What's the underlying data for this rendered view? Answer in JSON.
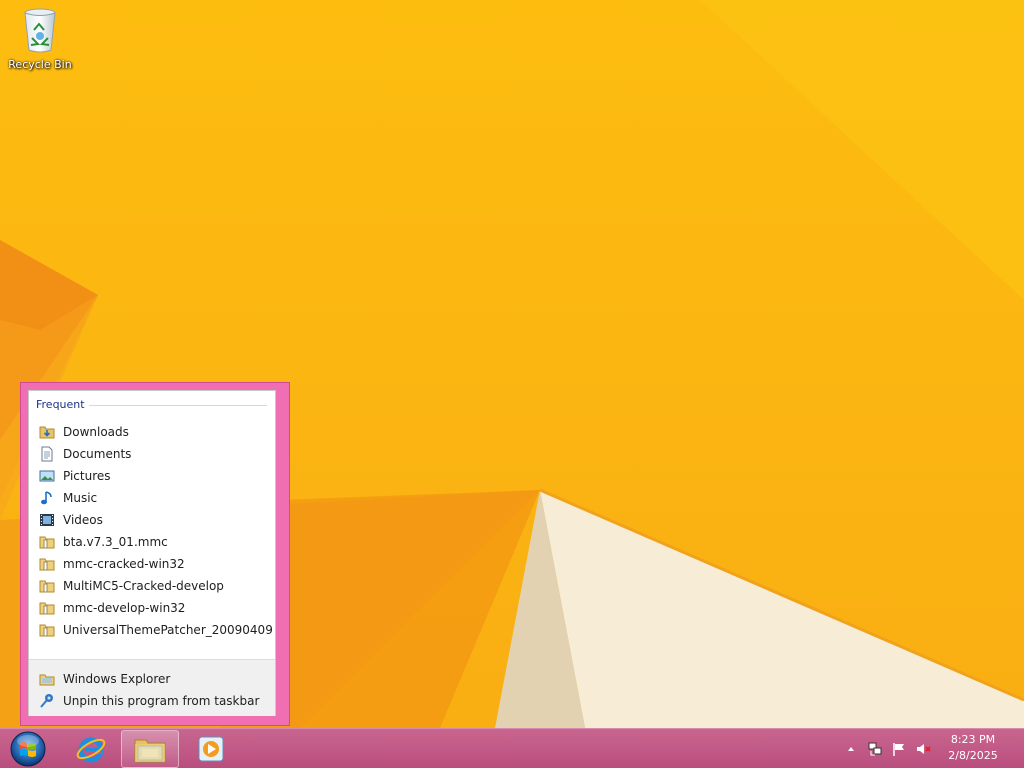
{
  "desktop": {
    "recycle_bin_label": "Recycle Bin"
  },
  "jumplist": {
    "header": "Frequent",
    "frequent_items": [
      {
        "label": "Downloads",
        "icon": "downloads-folder-icon"
      },
      {
        "label": "Documents",
        "icon": "documents-icon"
      },
      {
        "label": "Pictures",
        "icon": "pictures-icon"
      },
      {
        "label": "Music",
        "icon": "music-icon"
      },
      {
        "label": "Videos",
        "icon": "videos-icon"
      },
      {
        "label": "bta.v7.3_01.mmc",
        "icon": "folder-icon"
      },
      {
        "label": "mmc-cracked-win32",
        "icon": "folder-icon"
      },
      {
        "label": "MultiMC5-Cracked-develop",
        "icon": "folder-icon"
      },
      {
        "label": "mmc-develop-win32",
        "icon": "folder-icon"
      },
      {
        "label": "UniversalThemePatcher_20090409",
        "icon": "folder-icon"
      }
    ],
    "tasks": [
      {
        "label": "Windows Explorer",
        "icon": "windows-explorer-icon"
      },
      {
        "label": "Unpin this program from taskbar",
        "icon": "unpin-icon"
      }
    ]
  },
  "taskbar": {
    "clock": {
      "time": "8:23 PM",
      "date": "2/8/2025"
    },
    "colors": {
      "accent": "#f06fb3",
      "taskbar": "#c25a87"
    }
  }
}
